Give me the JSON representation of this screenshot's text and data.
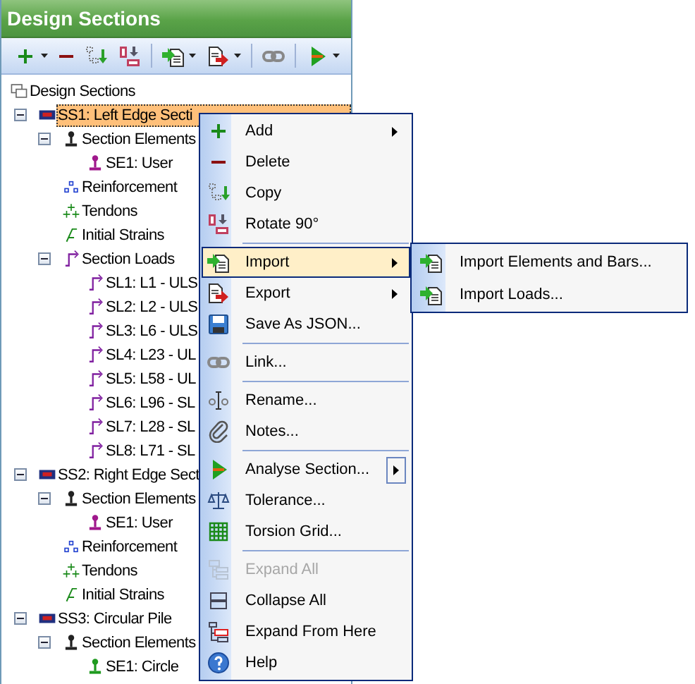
{
  "panel": {
    "title": "Design Sections"
  },
  "tree": {
    "label": "Design Sections",
    "kind": "root",
    "selected": false,
    "children": [
      {
        "label": "SS1: Left Edge Secti",
        "kind": "section",
        "selected": true,
        "expanded": true,
        "children": [
          {
            "label": "Section Elements",
            "kind": "elements",
            "selected": false,
            "expanded": true,
            "children": [
              {
                "label": "SE1: User",
                "kind": "element",
                "color": "#a0188c",
                "selected": false
              }
            ]
          },
          {
            "label": "Reinforcement",
            "kind": "reinforcement",
            "selected": false
          },
          {
            "label": "Tendons",
            "kind": "tendons",
            "selected": false
          },
          {
            "label": "Initial Strains",
            "kind": "strains",
            "selected": false
          },
          {
            "label": "Section Loads",
            "kind": "loads",
            "selected": false,
            "expanded": true,
            "children": [
              {
                "label": "SL1: L1 - ULS",
                "kind": "load",
                "selected": false
              },
              {
                "label": "SL2: L2 - ULS",
                "kind": "load",
                "selected": false
              },
              {
                "label": "SL3: L6 - ULS",
                "kind": "load",
                "selected": false
              },
              {
                "label": "SL4: L23 - UL",
                "kind": "load",
                "selected": false
              },
              {
                "label": "SL5: L58 - UL",
                "kind": "load",
                "selected": false
              },
              {
                "label": "SL6: L96 - SL",
                "kind": "load",
                "selected": false
              },
              {
                "label": "SL7: L28 - SL",
                "kind": "load",
                "selected": false
              },
              {
                "label": "SL8: L71 - SL",
                "kind": "load",
                "selected": false
              }
            ]
          }
        ]
      },
      {
        "label": "SS2: Right Edge Sect",
        "kind": "section",
        "selected": false,
        "expanded": true,
        "children": [
          {
            "label": "Section Elements",
            "kind": "elements",
            "selected": false,
            "expanded": true,
            "children": [
              {
                "label": "SE1: User",
                "kind": "element",
                "color": "#a0188c",
                "selected": false
              }
            ]
          },
          {
            "label": "Reinforcement",
            "kind": "reinforcement",
            "selected": false
          },
          {
            "label": "Tendons",
            "kind": "tendons",
            "selected": false
          },
          {
            "label": "Initial Strains",
            "kind": "strains",
            "selected": false
          }
        ]
      },
      {
        "label": "SS3: Circular Pile",
        "kind": "section",
        "selected": false,
        "expanded": true,
        "children": [
          {
            "label": "Section Elements",
            "kind": "elements",
            "selected": false,
            "expanded": true,
            "children": [
              {
                "label": "SE1: Circle",
                "kind": "element",
                "color": "#1f9a1f",
                "selected": false
              }
            ]
          }
        ]
      }
    ]
  },
  "context_menu": {
    "items": [
      {
        "kind": "item",
        "label": "Add",
        "submenu": true,
        "selected": false,
        "disabled": false
      },
      {
        "kind": "item",
        "label": "Delete",
        "submenu": false,
        "selected": false,
        "disabled": false
      },
      {
        "kind": "item",
        "label": "Copy",
        "submenu": false,
        "selected": false,
        "disabled": false
      },
      {
        "kind": "item",
        "label": "Rotate 90°",
        "submenu": false,
        "selected": false,
        "disabled": false
      },
      {
        "kind": "separator"
      },
      {
        "kind": "item",
        "label": "Import",
        "submenu": true,
        "selected": true,
        "disabled": false
      },
      {
        "kind": "item",
        "label": "Export",
        "submenu": true,
        "selected": false,
        "disabled": false
      },
      {
        "kind": "item",
        "label": "Save As JSON...",
        "submenu": false,
        "selected": false,
        "disabled": false
      },
      {
        "kind": "separator"
      },
      {
        "kind": "item",
        "label": "Link...",
        "submenu": false,
        "selected": false,
        "disabled": false
      },
      {
        "kind": "separator"
      },
      {
        "kind": "item",
        "label": "Rename...",
        "submenu": false,
        "selected": false,
        "disabled": false
      },
      {
        "kind": "item",
        "label": "Notes...",
        "submenu": false,
        "selected": false,
        "disabled": false
      },
      {
        "kind": "separator"
      },
      {
        "kind": "split-item",
        "label": "Analyse Section...",
        "submenu": true,
        "selected": false,
        "disabled": false
      },
      {
        "kind": "item",
        "label": "Tolerance...",
        "submenu": false,
        "selected": false,
        "disabled": false
      },
      {
        "kind": "item",
        "label": "Torsion Grid...",
        "submenu": false,
        "selected": false,
        "disabled": false
      },
      {
        "kind": "separator"
      },
      {
        "kind": "item",
        "label": "Expand All",
        "submenu": false,
        "selected": false,
        "disabled": true
      },
      {
        "kind": "item",
        "label": "Collapse All",
        "submenu": false,
        "selected": false,
        "disabled": false
      },
      {
        "kind": "item",
        "label": "Expand From Here",
        "submenu": false,
        "selected": false,
        "disabled": false
      },
      {
        "kind": "item",
        "label": "Help",
        "submenu": false,
        "selected": false,
        "disabled": false
      }
    ]
  },
  "submenu": {
    "items": [
      {
        "label": "Import Elements and Bars...",
        "selected": false
      },
      {
        "label": "Import Loads...",
        "selected": false
      }
    ]
  }
}
